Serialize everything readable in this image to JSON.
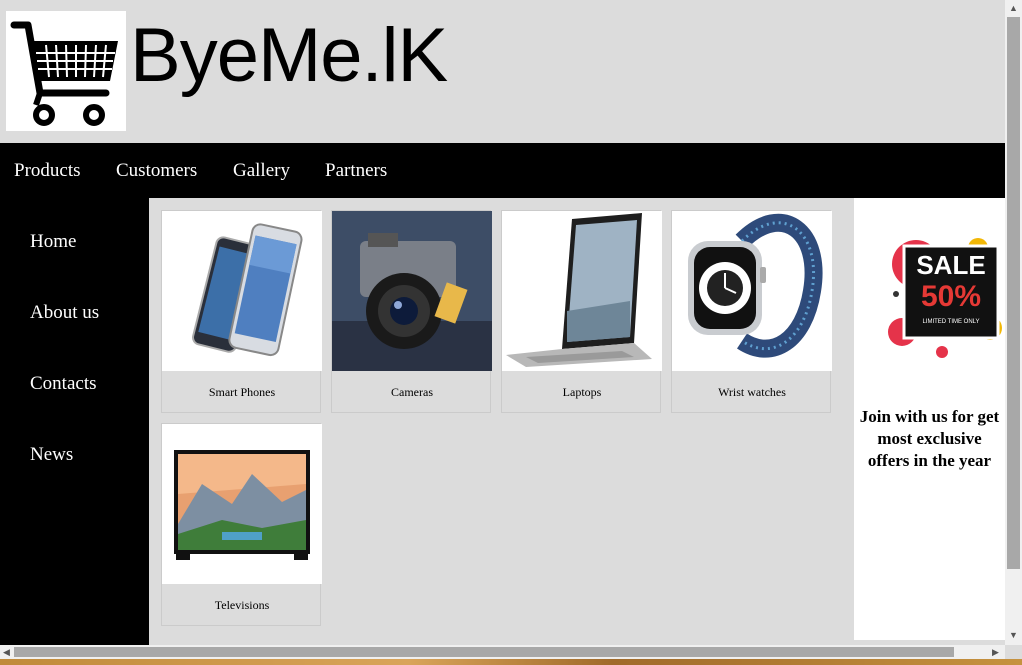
{
  "brand": {
    "name": "ByeMe.lK"
  },
  "top_nav": {
    "items": [
      "Products",
      "Customers",
      "Gallery",
      "Partners"
    ]
  },
  "sidebar": {
    "items": [
      "Home",
      "About us",
      "Contacts",
      "News"
    ]
  },
  "products": [
    {
      "caption": "Smart Phones",
      "icon": "smartphone-icon"
    },
    {
      "caption": "Cameras",
      "icon": "camera-icon"
    },
    {
      "caption": "Laptops",
      "icon": "laptop-icon"
    },
    {
      "caption": "Wrist watches",
      "icon": "watch-icon"
    },
    {
      "caption": "Televisions",
      "icon": "tv-icon"
    }
  ],
  "promo": {
    "sale_label": "SALE",
    "discount": "50%",
    "fine_print": "LIMITED TIME ONLY",
    "offer_text": "Join with us for get most exclusive offers in the year"
  },
  "colors": {
    "nav_bg": "#000000",
    "content_bg": "#dcdcdc",
    "sale_red": "#e53935"
  }
}
